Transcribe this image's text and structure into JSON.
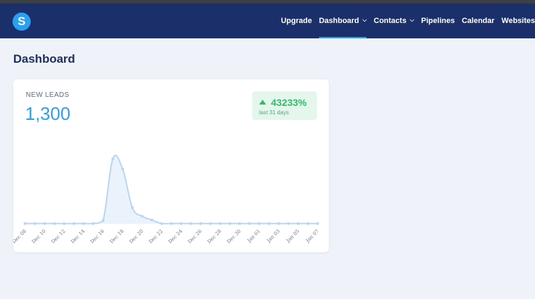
{
  "nav": {
    "logo_letter": "S",
    "items": [
      {
        "label": "Upgrade",
        "dropdown": false,
        "active": false
      },
      {
        "label": "Dashboard",
        "dropdown": true,
        "active": true
      },
      {
        "label": "Contacts",
        "dropdown": true,
        "active": false
      },
      {
        "label": "Pipelines",
        "dropdown": false,
        "active": false
      },
      {
        "label": "Calendar",
        "dropdown": false,
        "active": false
      },
      {
        "label": "Websites",
        "dropdown": false,
        "active": false
      }
    ]
  },
  "page": {
    "title": "Dashboard"
  },
  "card": {
    "label": "NEW LEADS",
    "value": "1,300",
    "badge": {
      "percent": "43233%",
      "period": "last 31 days",
      "direction": "up",
      "color": "#2dbf68"
    }
  },
  "chart_data": {
    "type": "area",
    "title": "",
    "xlabel": "",
    "ylabel": "",
    "color": "#b9d6f5",
    "x": [
      "Dec 08",
      "Dec 09",
      "Dec 10",
      "Dec 11",
      "Dec 12",
      "Dec 13",
      "Dec 14",
      "Dec 15",
      "Dec 16",
      "Dec 17",
      "Dec 18",
      "Dec 19",
      "Dec 20",
      "Dec 21",
      "Dec 22",
      "Dec 23",
      "Dec 24",
      "Dec 25",
      "Dec 26",
      "Dec 27",
      "Dec 28",
      "Dec 29",
      "Dec 30",
      "Dec 31",
      "Jan 01",
      "Jan 02",
      "Jan 03",
      "Jan 04",
      "Jan 05",
      "Jan 06",
      "Jan 07"
    ],
    "values": [
      3,
      3,
      3,
      3,
      3,
      3,
      3,
      3,
      60,
      1210,
      1020,
      300,
      140,
      70,
      3,
      3,
      3,
      3,
      3,
      3,
      3,
      3,
      3,
      3,
      3,
      3,
      3,
      3,
      3,
      3,
      3
    ],
    "tick_labels": [
      "Dec 08",
      "Dec 10",
      "Dec 12",
      "Dec 14",
      "Dec 16",
      "Dec 18",
      "Dec 20",
      "Dec 22",
      "Dec 24",
      "Dec 26",
      "Dec 28",
      "Dec 30",
      "Jan 01",
      "Jan 03",
      "Jan 05",
      "Jan 07"
    ],
    "ylim": [
      0,
      1300
    ],
    "grid": false
  }
}
